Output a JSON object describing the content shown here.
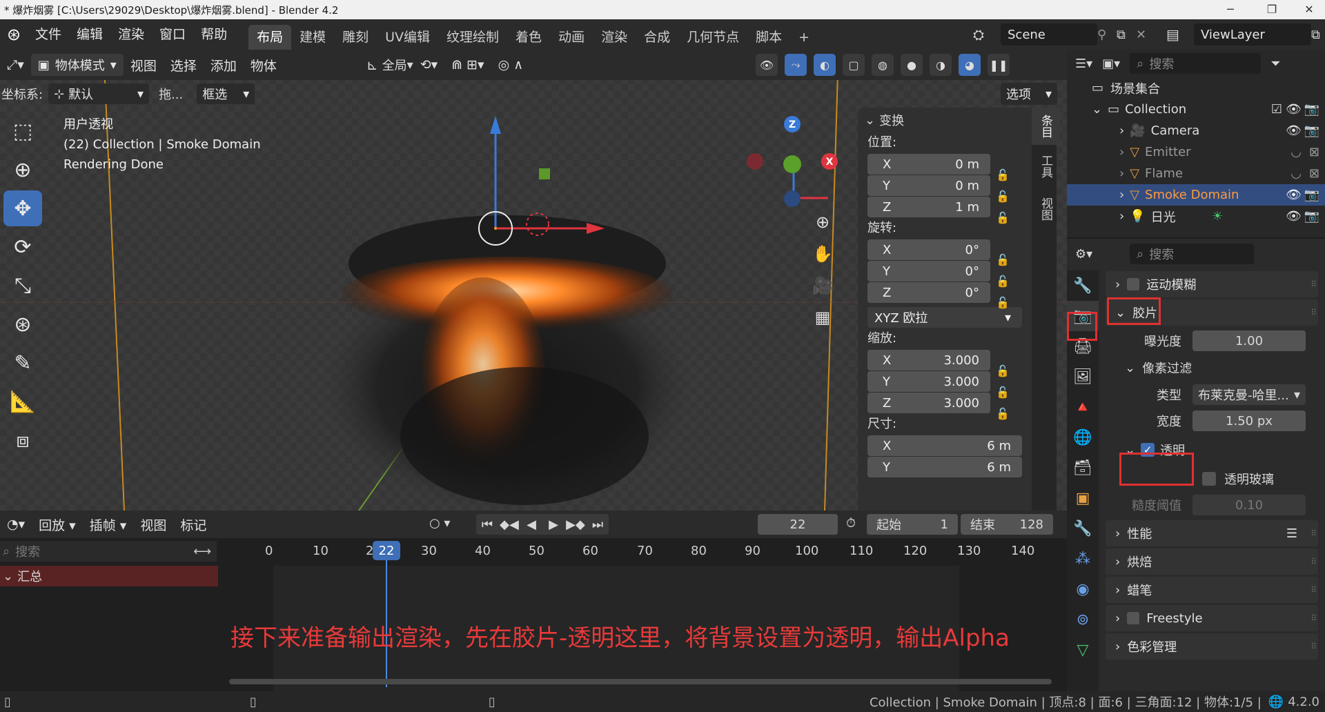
{
  "window": {
    "title": "* 爆炸烟雾 [C:\\Users\\29029\\Desktop\\爆炸烟雾.blend] - Blender 4.2"
  },
  "menu": [
    "文件",
    "编辑",
    "渲染",
    "窗口",
    "帮助"
  ],
  "workspaces": [
    "布局",
    "建模",
    "雕刻",
    "UV编辑",
    "纹理绘制",
    "着色",
    "动画",
    "渲染",
    "合成",
    "几何节点",
    "脚本"
  ],
  "scene": {
    "name": "Scene",
    "view_layer": "ViewLayer"
  },
  "viewport_header": {
    "mode": "物体模式",
    "menus": [
      "视图",
      "选择",
      "添加",
      "物体"
    ],
    "transform_orient": "全局",
    "coord_label": "坐标系:",
    "coord_value": "默认",
    "drag_label": "拖...",
    "select_mode": "框选",
    "options": "选项"
  },
  "viewport_info": {
    "line1": "用户透视",
    "line2": "(22) Collection | Smoke Domain",
    "line3": "Rendering Done"
  },
  "npanel": {
    "header": "变换",
    "location_label": "位置:",
    "location": [
      {
        "axis": "X",
        "value": "0 m"
      },
      {
        "axis": "Y",
        "value": "0 m"
      },
      {
        "axis": "Z",
        "value": "1 m"
      }
    ],
    "rotation_label": "旋转:",
    "rotation": [
      {
        "axis": "X",
        "value": "0°"
      },
      {
        "axis": "Y",
        "value": "0°"
      },
      {
        "axis": "Z",
        "value": "0°"
      }
    ],
    "rotation_mode": "XYZ 欧拉",
    "scale_label": "缩放:",
    "scale": [
      {
        "axis": "X",
        "value": "3.000"
      },
      {
        "axis": "Y",
        "value": "3.000"
      },
      {
        "axis": "Z",
        "value": "3.000"
      }
    ],
    "dims_label": "尺寸:",
    "dims": [
      {
        "axis": "X",
        "value": "6 m"
      },
      {
        "axis": "Y",
        "value": "6 m"
      }
    ],
    "tabs": [
      "条目",
      "工具",
      "视图"
    ]
  },
  "outliner": {
    "search_placeholder": "搜索",
    "root": "场景集合",
    "collection": "Collection",
    "items": [
      {
        "name": "Camera",
        "selected": false
      },
      {
        "name": "Emitter",
        "selected": false
      },
      {
        "name": "Flame",
        "selected": false
      },
      {
        "name": "Smoke Domain",
        "selected": true
      },
      {
        "name": "日光",
        "selected": false
      }
    ]
  },
  "properties": {
    "search_placeholder": "搜索",
    "motion_blur": "运动模糊",
    "film": "胶片",
    "exposure_label": "曝光度",
    "exposure": "1.00",
    "pixel_filter": "像素过滤",
    "type_label": "类型",
    "type_value": "布莱克曼-哈里...",
    "width_label": "宽度",
    "width_value": "1.50 px",
    "transparent": "透明",
    "transparent_glass": "透明玻璃",
    "roughness_label": "糙度阈值",
    "roughness_value": "0.10",
    "sections": [
      "性能",
      "烘焙",
      "蜡笔",
      "Freestyle",
      "色彩管理"
    ]
  },
  "timeline": {
    "menus": [
      "回放",
      "插帧",
      "视图",
      "标记"
    ],
    "current_frame": "22",
    "start_label": "起始",
    "start": "1",
    "end_label": "结束",
    "end": "128",
    "search_placeholder": "搜索",
    "summary": "汇总",
    "ticks": [
      "0",
      "10",
      "20",
      "30",
      "40",
      "50",
      "60",
      "70",
      "80",
      "90",
      "100",
      "110",
      "120",
      "130",
      "140"
    ]
  },
  "annotation": "接下来准备输出渲染，先在胶片-透明这里，将背景设置为透明，输出Alpha",
  "status": {
    "text": "Collection | Smoke Domain | 顶点:8 | 面:6 | 三角面:12 | 物体:1/5 |",
    "version": "4.2.0"
  },
  "colors": {
    "accent": "#3f6fb6",
    "highlight": "#e03030",
    "selected_text": "#ff9a3c",
    "fire": "#ff7a1a"
  }
}
